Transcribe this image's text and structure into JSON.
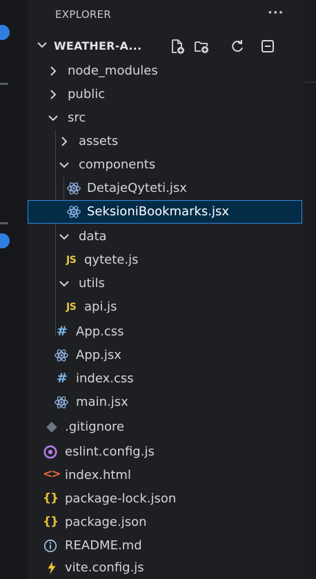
{
  "explorer": {
    "title": "EXPLORER",
    "more_label": "···",
    "project_name": "WEATHER-A...",
    "actions": [
      {
        "name": "new-file-icon"
      },
      {
        "name": "new-folder-icon"
      },
      {
        "name": "refresh-icon"
      },
      {
        "name": "collapse-all-icon"
      }
    ]
  },
  "tree": {
    "node_modules": "node_modules",
    "public": "public",
    "src": "src",
    "assets": "assets",
    "components": "components",
    "detaje": "DetajeQyteti.jsx",
    "seksioni": "SeksioniBookmarks.jsx",
    "data": "data",
    "qytete": "qytete.js",
    "utils": "utils",
    "api": "api.js",
    "app_css": "App.css",
    "app_jsx": "App.jsx",
    "index_css": "index.css",
    "main_jsx": "main.jsx",
    "gitignore": ".gitignore",
    "eslint": "eslint.config.js",
    "index_html": "index.html",
    "package_lock": "package-lock.json",
    "package_json": "package.json",
    "readme": "README.md",
    "vite": "vite.config.js"
  },
  "glyphs": {
    "js": "JS",
    "hash": "#",
    "braces": "{}",
    "angle": "<>"
  },
  "colors": {
    "react": "#8fb6e8",
    "js": "#e8c84a",
    "css": "#7ab7ea",
    "json": "#e2c33a",
    "html": "#e7673a",
    "eslint": "#b07ae0",
    "info": "#a7c8f0",
    "vite": "#f2c531",
    "gitignore": "#6e7781",
    "selection": "#042c47",
    "selection_border": "#2f89e0",
    "accent_dot": "#2f7fe0"
  }
}
